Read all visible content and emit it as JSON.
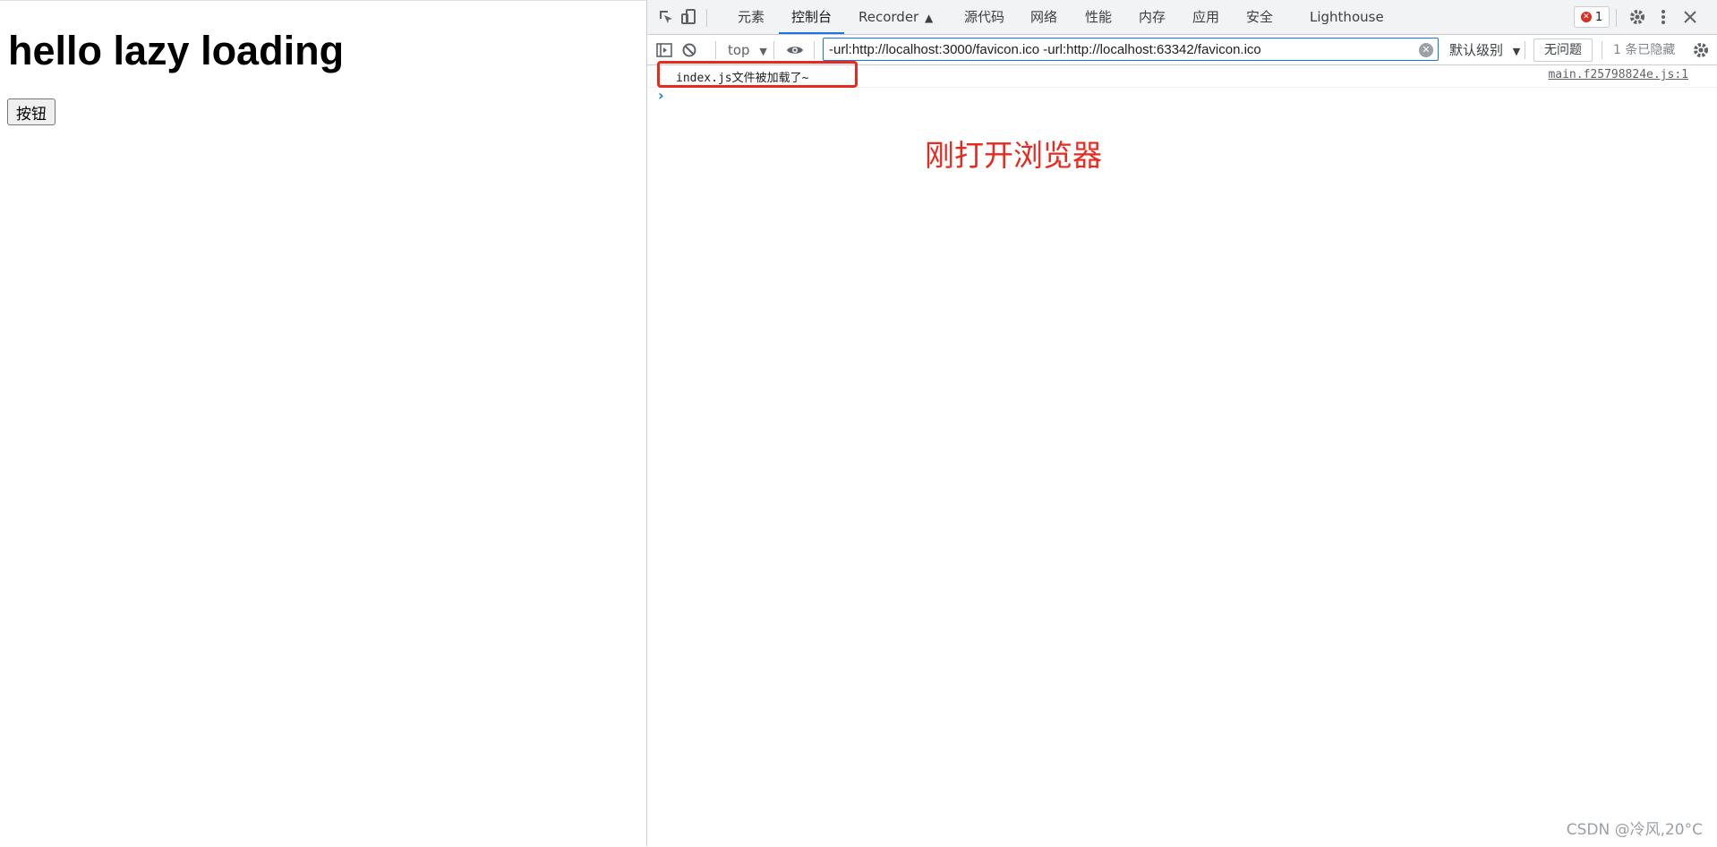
{
  "page": {
    "heading": "hello lazy loading",
    "button_label": "按钮"
  },
  "devtools": {
    "tabs": [
      "元素",
      "控制台",
      "Recorder",
      "源代码",
      "网络",
      "性能",
      "内存",
      "应用",
      "安全",
      "Lighthouse"
    ],
    "active_tab": "控制台",
    "error_count": "1",
    "toolbar": {
      "context": "top",
      "filter_value": "-url:http://localhost:3000/favicon.ico -url:http://localhost:63342/favicon.ico",
      "level": "默认级别",
      "issues_label": "无问题",
      "hidden_count": "1 条已隐藏"
    },
    "console": {
      "messages": [
        {
          "text": "index.js文件被加载了~",
          "source": "main.f25798824e.js:1"
        }
      ],
      "prompt": "›"
    },
    "annotation": "刚打开浏览器"
  },
  "watermark": "CSDN @冷风,20°C",
  "colors": {
    "accent": "#1a73e8",
    "annotation_red": "#e8291e",
    "error_red": "#d93025"
  },
  "icons": [
    "inspect-icon",
    "device-toolbar-icon",
    "flask-icon",
    "gear-icon",
    "more-vertical-icon",
    "close-icon",
    "sidebar-toggle-icon",
    "clear-console-icon",
    "eye-icon",
    "dropdown-caret-icon",
    "console-settings-icon"
  ]
}
